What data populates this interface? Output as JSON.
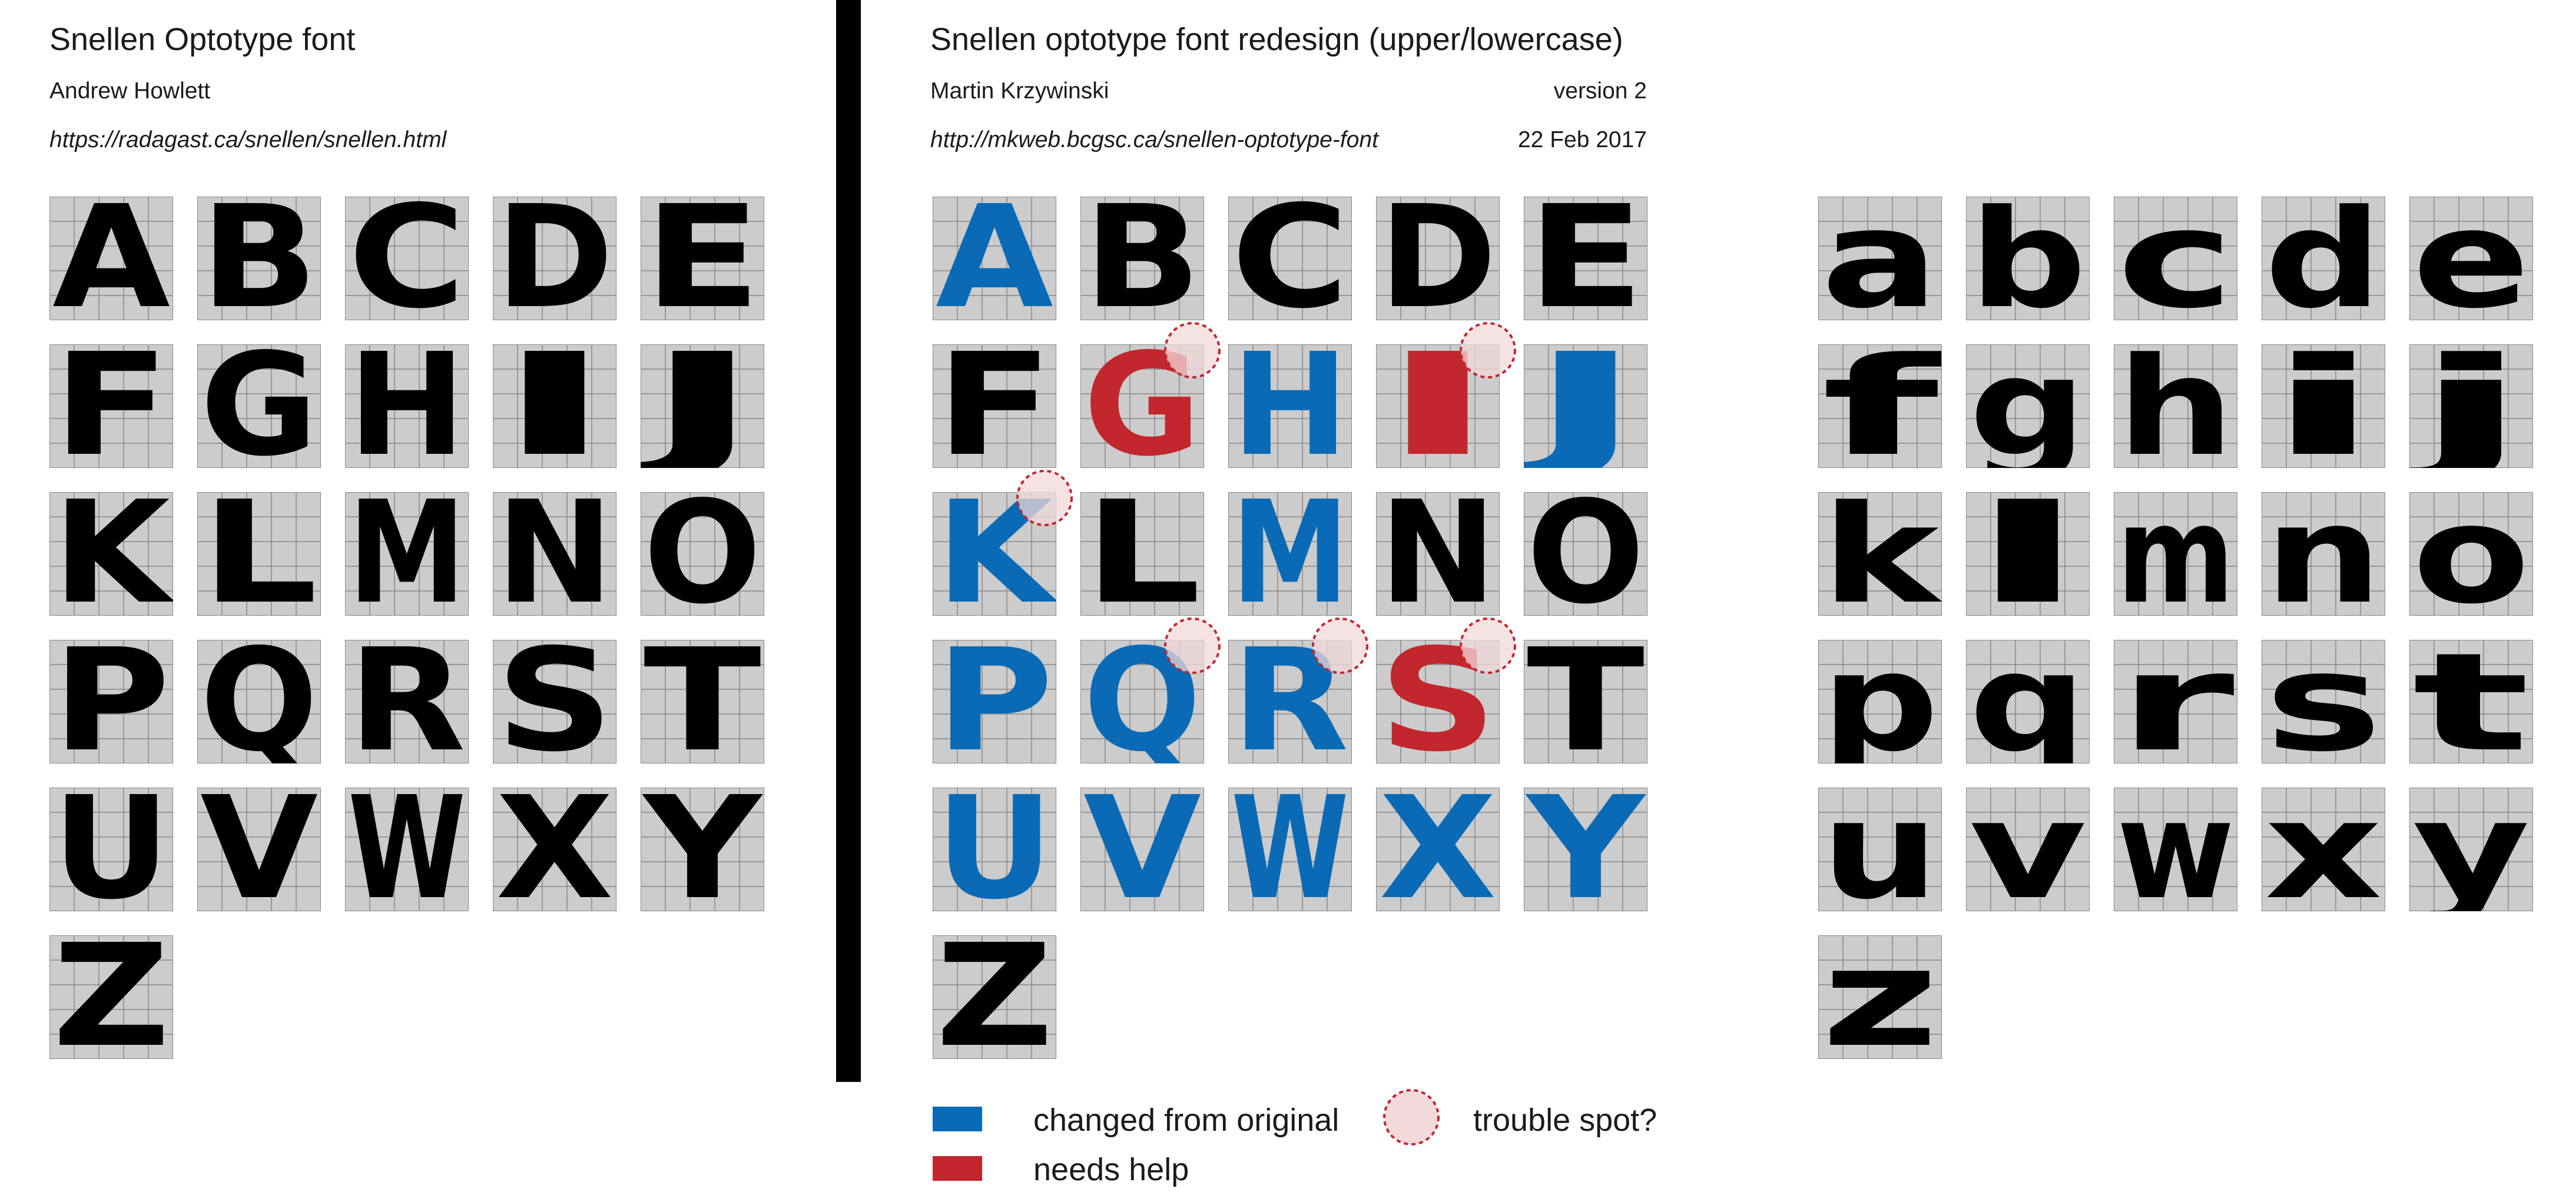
{
  "colors": {
    "background": "#ffffff",
    "glyph": "#000000",
    "changed": "#0a6ab5",
    "needs_help": "#c1272d",
    "grid_fill": "#cccccc",
    "grid_line": "#888888",
    "trouble_fill": "#f2d9db",
    "trouble_stroke": "#c1272d"
  },
  "panels": {
    "original": {
      "title": "Snellen Optotype font",
      "author": "Andrew Howlett",
      "url": "https://radagast.ca/snellen/snellen.html"
    },
    "redesign": {
      "title": "Snellen optotype font redesign (upper/lowercase)",
      "author": "Martin Krzywinski",
      "version": "version 2",
      "url": "http://mkweb.bcgsc.ca/snellen-optotype-font",
      "date": "22 Feb 2017"
    }
  },
  "alphabets": {
    "original": [
      "A",
      "B",
      "C",
      "D",
      "E",
      "F",
      "G",
      "H",
      "I",
      "J",
      "K",
      "L",
      "M",
      "N",
      "O",
      "P",
      "Q",
      "R",
      "S",
      "T",
      "U",
      "V",
      "W",
      "X",
      "Y",
      "Z"
    ],
    "uppercase": [
      "A",
      "B",
      "C",
      "D",
      "E",
      "F",
      "G",
      "H",
      "I",
      "J",
      "K",
      "L",
      "M",
      "N",
      "O",
      "P",
      "Q",
      "R",
      "S",
      "T",
      "U",
      "V",
      "W",
      "X",
      "Y",
      "Z"
    ],
    "lowercase": [
      "a",
      "b",
      "c",
      "d",
      "e",
      "f",
      "g",
      "h",
      "i",
      "j",
      "k",
      "l",
      "m",
      "n",
      "o",
      "p",
      "q",
      "r",
      "s",
      "t",
      "u",
      "v",
      "w",
      "x",
      "y",
      "z"
    ]
  },
  "letter_status": {
    "changed": [
      "A",
      "H",
      "J",
      "K",
      "M",
      "P",
      "Q",
      "R",
      "U",
      "V",
      "W",
      "X",
      "Y"
    ],
    "needs_help": [
      "G",
      "I",
      "S"
    ]
  },
  "trouble_spots": [
    "G",
    "I",
    "K",
    "Q",
    "R",
    "S"
  ],
  "legend": {
    "changed_label": "changed from original",
    "needs_help_label": "needs help",
    "trouble_label": "trouble spot?"
  }
}
